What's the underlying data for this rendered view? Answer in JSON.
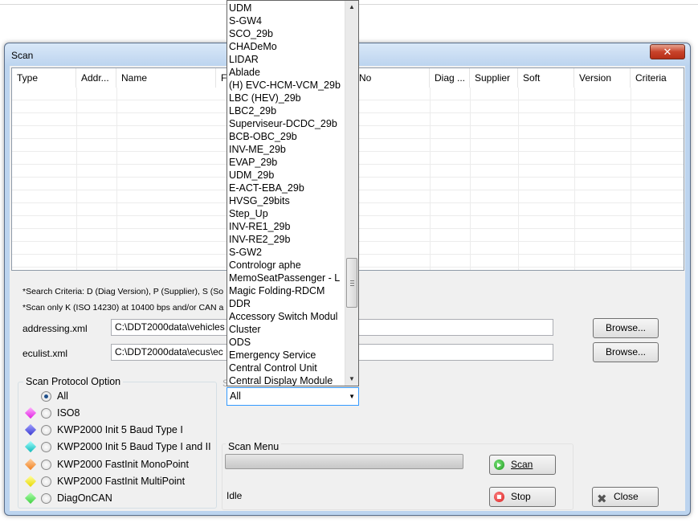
{
  "window": {
    "title": "Scan",
    "close_glyph": "✕"
  },
  "list": {
    "columns": [
      "Type",
      "Addr...",
      "Name",
      "Fi",
      "No",
      "Diag ...",
      "Supplier",
      "Soft",
      "Version",
      "Criteria"
    ]
  },
  "notes": {
    "search_criteria": "*Search Criteria: D (Diag Version), P (Supplier), S (So",
    "scan_only": "*Scan only K (ISO 14230) at 10400 bps and/or CAN a"
  },
  "files": {
    "addressing_label": "addressing.xml",
    "addressing_value": "C:\\DDT2000data\\vehicles",
    "eculist_label": "eculist.xml",
    "eculist_value": "C:\\DDT2000data\\ecus\\ec",
    "browse_label": "Browse..."
  },
  "protocol": {
    "title": "Scan Protocol Option",
    "options": [
      {
        "label": "All",
        "color": "",
        "checked": true
      },
      {
        "label": "ISO8",
        "color": "#e020e0"
      },
      {
        "label": "KWP2000 Init 5 Baud Type I",
        "color": "#3a3ad0"
      },
      {
        "label": "KWP2000 Init 5 Baud Type I and II",
        "color": "#10b8b8"
      },
      {
        "label": "KWP2000 FastInit MonoPoint",
        "color": "#f08020"
      },
      {
        "label": "KWP2000 FastInit MultiPoint",
        "color": "#e8d800"
      },
      {
        "label": "DiagOnCAN",
        "color": "#40d040"
      }
    ]
  },
  "dropdown": {
    "selected": "All",
    "items": [
      "UDM",
      "S-GW4",
      "SCO_29b",
      "CHADeMo",
      "LIDAR",
      "Ablade",
      "(H) EVC-HCM-VCM_29b",
      "LBC (HEV)_29b",
      "LBC2_29b",
      "Superviseur-DCDC_29b",
      "BCB-OBC_29b",
      "INV-ME_29b",
      "EVAP_29b",
      "UDM_29b",
      "E-ACT-EBA_29b",
      "HVSG_29bits",
      "Step_Up",
      "INV-RE1_29b",
      "INV-RE2_29b",
      "S-GW2",
      "Contrologr aphe",
      "MemoSeatPassenger - L",
      "Magic Folding-RDCM",
      "DDR",
      "Accessory Switch Modul",
      "Cluster",
      "ODS",
      "Emergency Service",
      "Central Control Unit",
      "Central Display Module"
    ]
  },
  "scan_menu": {
    "title": "Scan Menu",
    "status": "Idle",
    "scan_label": "Scan",
    "stop_label": "Stop",
    "close_label": "Close",
    "hidden_label_fragment": "S"
  }
}
